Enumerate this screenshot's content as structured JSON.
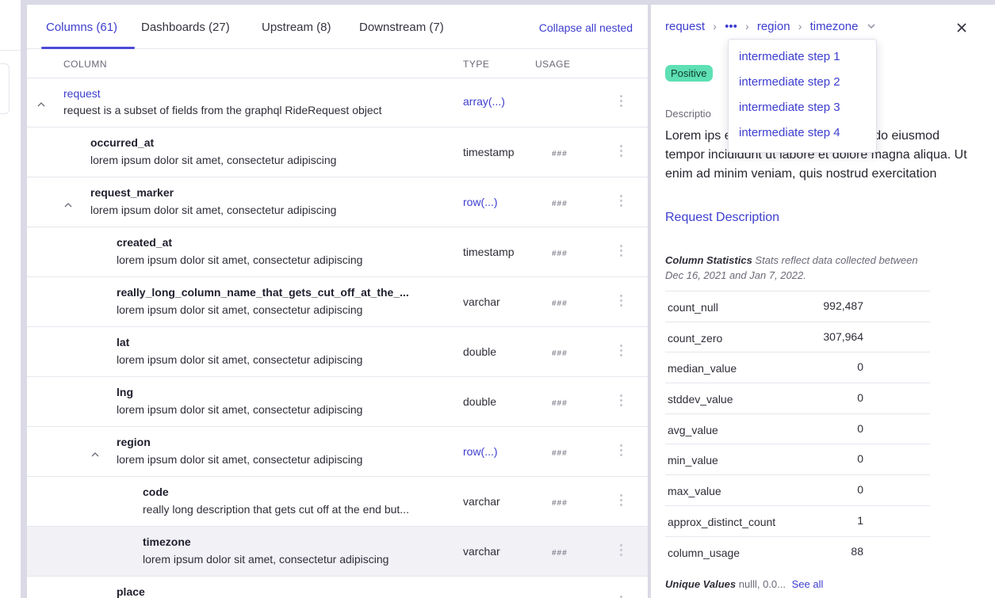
{
  "tabs": [
    {
      "label": "Columns (61)"
    },
    {
      "label": "Dashboards (27)"
    },
    {
      "label": "Upstream (8)"
    },
    {
      "label": "Downstream (7)"
    }
  ],
  "collapse_all_label": "Collapse all nested",
  "headers": {
    "column": "COLUMN",
    "type": "TYPE",
    "usage": "USAGE"
  },
  "rows": [
    {
      "name": "request",
      "description": "request is a subset of fields from the graphql RideRequest object",
      "type": "array(...)",
      "usage": ""
    },
    {
      "name": "occurred_at",
      "description": "lorem ipsum dolor sit amet, consectetur adipiscing",
      "type": "timestamp",
      "usage": "###"
    },
    {
      "name": "request_marker",
      "description": "lorem ipsum dolor sit amet, consectetur adipiscing",
      "type": "row(...)",
      "usage": "###"
    },
    {
      "name": "created_at",
      "description": "lorem ipsum dolor sit amet, consectetur adipiscing",
      "type": "timestamp",
      "usage": "###"
    },
    {
      "name": "really_long_column_name_that_gets_cut_off_at_the_...",
      "description": "lorem ipsum dolor sit amet, consectetur adipiscing",
      "type": "varchar",
      "usage": "###"
    },
    {
      "name": "lat",
      "description": "lorem ipsum dolor sit amet, consectetur adipiscing",
      "type": "double",
      "usage": "###"
    },
    {
      "name": "lng",
      "description": "lorem ipsum dolor sit amet, consectetur adipiscing",
      "type": "double",
      "usage": "###"
    },
    {
      "name": "region",
      "description": "lorem ipsum dolor sit amet, consectetur adipiscing",
      "type": "row(...)",
      "usage": "###"
    },
    {
      "name": "code",
      "description": "really long description that gets cut off at the end but...",
      "type": "varchar",
      "usage": "###"
    },
    {
      "name": "timezone",
      "description": "lorem ipsum dolor sit amet, consectetur adipiscing",
      "type": "varchar",
      "usage": "###"
    },
    {
      "name": "place",
      "description": "",
      "type": "",
      "usage": ""
    }
  ],
  "side": {
    "breadcrumb": {
      "first": "request",
      "ellipsis": "•••",
      "second": "region",
      "current": "timezone"
    },
    "dropdown": [
      "intermediate step 1",
      "intermediate step 2",
      "intermediate step 3",
      "intermediate step 4"
    ],
    "badge": "Positive",
    "description_label": "Descriptio",
    "description_text": "Lorem ips                                   ectetur adipiscing elit, sed do eiusmod tempor incididunt ut labore et dolore magna aliqua. Ut enim ad minim veniam, quis nostrud exercitation",
    "description_link": "Request Description",
    "stats_title": "Column Statistics",
    "stats_note": "Stats reflect data collected between Dec 16, 2021 and Jan 7, 2022.",
    "stats": [
      {
        "key": "count_null",
        "value": "992,487"
      },
      {
        "key": "count_zero",
        "value": "307,964"
      },
      {
        "key": "median_value",
        "value": "0"
      },
      {
        "key": "stddev_value",
        "value": "0"
      },
      {
        "key": "avg_value",
        "value": "0"
      },
      {
        "key": "min_value",
        "value": "0"
      },
      {
        "key": "max_value",
        "value": "0"
      },
      {
        "key": "approx_distinct_count",
        "value": "1"
      },
      {
        "key": "column_usage",
        "value": "88"
      }
    ],
    "unique_label": "Unique Values",
    "unique_values": "nulll, 0.0...",
    "see_all": "See all"
  },
  "colors": {
    "accent": "#3d3dcf",
    "badge": "#5ee0b4",
    "frame": "#dadae6",
    "selected_row": "#f1f1f6"
  },
  "icons": {
    "expand": "chevron-up-icon",
    "menu": "kebab-menu-icon",
    "close": "close-icon",
    "separator": "chevron-right-icon"
  }
}
